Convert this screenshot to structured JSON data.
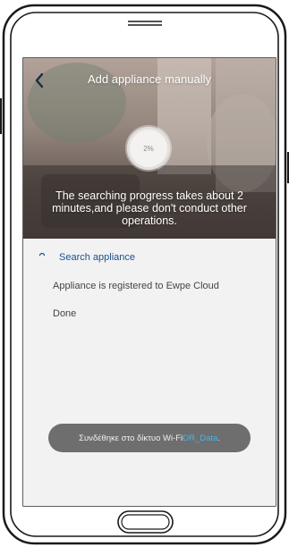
{
  "header": {
    "title": "Add appliance manually",
    "back_icon": "chevron-left-icon"
  },
  "progress": {
    "percent_text": "2%",
    "value": 2
  },
  "hero": {
    "message": "The searching progress takes about 2 minutes,and please don't conduct other operations."
  },
  "steps": [
    {
      "label": "Search appliance",
      "state": "in-progress",
      "color": "#1b4f8f"
    },
    {
      "label": "Appliance is registered to Ewpe Cloud",
      "state": "pending"
    },
    {
      "label": "Done",
      "state": "pending"
    }
  ],
  "toast": {
    "prefix": "Συνδέθηκε στο δίκτυο Wi-Fi ",
    "network": "DR_Data",
    "suffix": ".",
    "network_color": "#45b4e6"
  },
  "colors": {
    "hero_overlay": "#5a4e49",
    "screen_bg": "#f2f2f2",
    "accent": "#1b4f8f"
  }
}
